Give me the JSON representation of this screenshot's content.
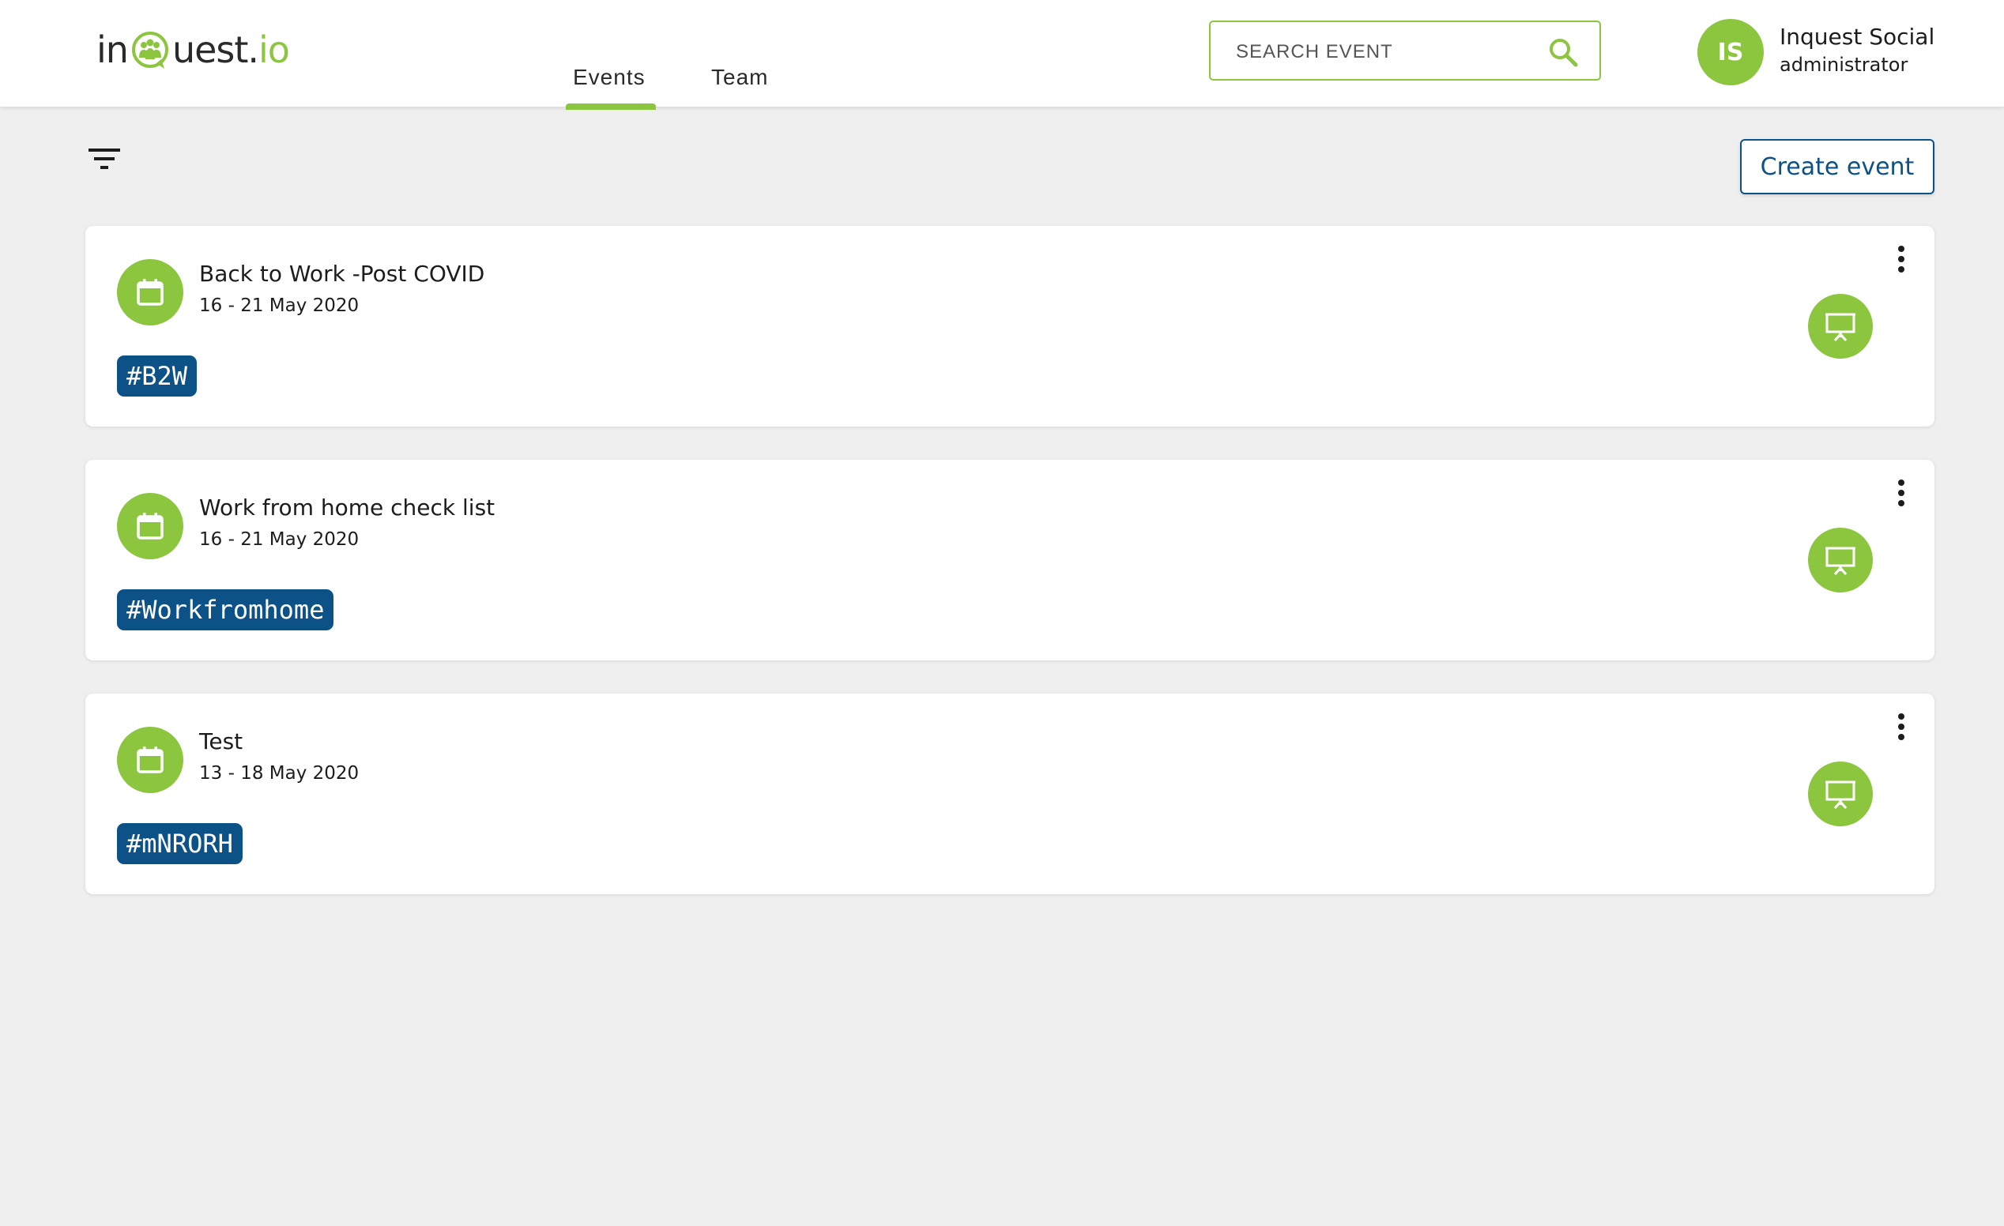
{
  "brand": {
    "logo_prefix": "in",
    "logo_suffix": "uest.",
    "logo_tld": "io",
    "accent_color": "#8cc63f",
    "primary_color": "#0d5287"
  },
  "nav": {
    "tabs": [
      {
        "label": "Events",
        "active": true
      },
      {
        "label": "Team",
        "active": false
      }
    ]
  },
  "search": {
    "placeholder": "SEARCH EVENT",
    "value": "",
    "icon": "search-icon"
  },
  "user": {
    "initials": "IS",
    "name": "Inquest Social",
    "role": "administrator"
  },
  "toolbar": {
    "filter_icon": "filter-icon",
    "create_label": "Create event"
  },
  "events": [
    {
      "title": "Back to Work -Post COVID",
      "dates": "16 - 21 May 2020",
      "tag": "#B2W"
    },
    {
      "title": "Work from home check list",
      "dates": "16 - 21 May 2020",
      "tag": "#Workfromhome"
    },
    {
      "title": "Test",
      "dates": "13 - 18 May 2020",
      "tag": "#mNRORH"
    }
  ]
}
